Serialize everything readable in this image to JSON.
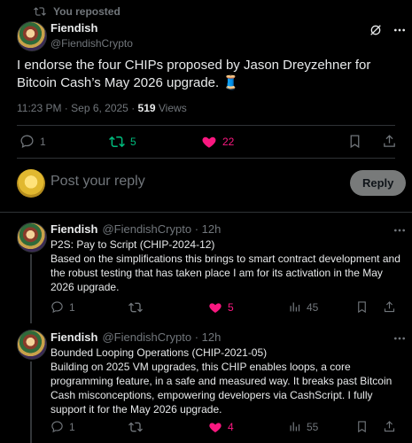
{
  "repost_banner": {
    "text": "You reposted"
  },
  "main_post": {
    "name": "Fiendish",
    "handle": "@FiendishCrypto",
    "text": "I endorse the four CHIPs proposed by Jason Dreyzehner for Bitcoin Cash’s May 2026 upgrade. 🧵",
    "time_date": "11:23 PM · Sep 6, 2025 · ",
    "views_count": "519",
    "views_label": " Views",
    "actions": {
      "replies": "1",
      "reposts": "5",
      "likes": "22"
    }
  },
  "reply_box": {
    "placeholder": "Post your reply",
    "button": "Reply"
  },
  "replies": [
    {
      "name": "Fiendish",
      "handle_time": "@FiendishCrypto · 12h",
      "title": "P2S: Pay to Script (CHIP-2024-12)",
      "body": "Based on the simplifications this brings to smart contract development and the robust testing that has taken place I am for its activation in the May 2026 upgrade.",
      "actions": {
        "replies": "1",
        "likes": "5",
        "views": "45"
      }
    },
    {
      "name": "Fiendish",
      "handle_time": "@FiendishCrypto · 12h",
      "title": "Bounded Looping Operations (CHIP-2021-05)",
      "body": "Building on 2025 VM upgrades, this CHIP enables loops, a core programming feature, in a safe and measured way. It breaks past Bitcoin Cash misconceptions, empowering developers via CashScript. I fully support it for the May 2026 upgrade.",
      "actions": {
        "replies": "1",
        "likes": "4",
        "views": "55"
      }
    }
  ],
  "colors": {
    "background": "#000000",
    "text": "#e7e9ea",
    "muted": "#71767b",
    "repost": "#00ba7c",
    "like": "#f91880",
    "divider": "#2f3336"
  },
  "icons": [
    "repost-icon",
    "grok-icon",
    "more-icon",
    "reply-icon",
    "heart-icon",
    "bookmark-icon",
    "share-icon",
    "views-icon"
  ]
}
